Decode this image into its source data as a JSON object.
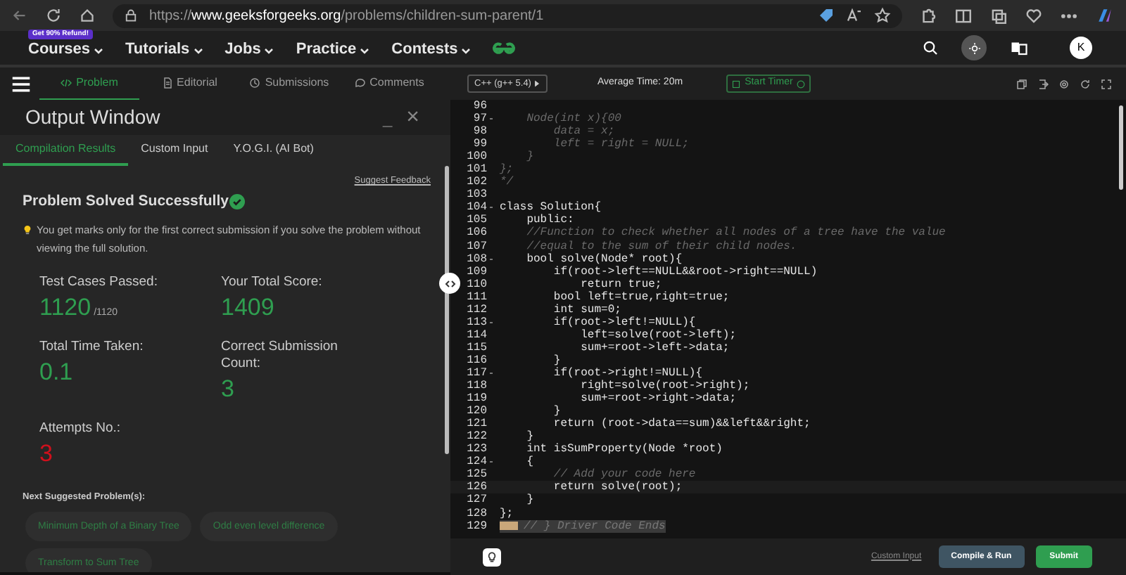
{
  "browser": {
    "url_host": "www.geeksforgeeks.org",
    "url_prefix": "https://",
    "url_path": "/problems/children-sum-parent/1"
  },
  "site_nav": {
    "badge": "Get 90% Refund!",
    "items": [
      {
        "label": "Courses"
      },
      {
        "label": "Tutorials"
      },
      {
        "label": "Jobs"
      },
      {
        "label": "Practice"
      },
      {
        "label": "Contests"
      }
    ],
    "avatar": "K"
  },
  "problem_tabs": [
    {
      "label": "Problem",
      "selected": true
    },
    {
      "label": "Editorial",
      "selected": false
    },
    {
      "label": "Submissions",
      "selected": false
    },
    {
      "label": "Comments",
      "selected": false
    }
  ],
  "output_window": {
    "title": "Output Window",
    "minimize": "_",
    "close": "×",
    "tabs": [
      {
        "label": "Compilation Results",
        "selected": true
      },
      {
        "label": "Custom Input",
        "selected": false
      },
      {
        "label": "Y.O.G.I. (AI Bot)",
        "selected": false
      }
    ],
    "feedback_link": "Suggest Feedback",
    "result_title": "Problem Solved Successfully",
    "note": "You get marks only for the first correct submission if you solve the problem without viewing the full solution.",
    "stats": [
      {
        "label": "Test Cases Passed:",
        "value": "1120",
        "suffix": "/1120",
        "color": "#2f9e50"
      },
      {
        "label": "Your Total Score:",
        "value": "1409",
        "color": "#2f9e50"
      },
      {
        "label": "Total Time Taken:",
        "value": "0.1",
        "color": "#2f9e50"
      },
      {
        "label": "Correct Submission Count:",
        "value": "3",
        "color": "#2f9e50"
      },
      {
        "label": "Attempts No.:",
        "value": "3",
        "color": "#d0101c"
      }
    ],
    "suggested_heading": "Next Suggested Problem(s):",
    "suggested": [
      "Minimum Depth of a Binary Tree",
      "Odd even level difference",
      "Transform to Sum Tree"
    ]
  },
  "editor": {
    "language": "C++ (g++ 5.4)",
    "average_time": "Average Time: 20m",
    "timer_button": "Start Timer",
    "lines": [
      {
        "n": "96",
        "kind": "comment",
        "fold": false
      },
      {
        "n": "97",
        "text": "    Node(int x){00",
        "kind": "comment",
        "fold": true
      },
      {
        "n": "98",
        "text": "        data = x;",
        "kind": "comment",
        "fold": false
      },
      {
        "n": "99",
        "text": "        left = right = NULL;",
        "kind": "comment",
        "fold": false
      },
      {
        "n": "100",
        "text": "    }",
        "kind": "comment",
        "fold": false
      },
      {
        "n": "101",
        "text": "};",
        "kind": "comment",
        "fold": false
      },
      {
        "n": "102",
        "text": "*/",
        "kind": "comment",
        "fold": false
      },
      {
        "n": "103",
        "kind": "code",
        "fold": false
      },
      {
        "n": "104",
        "text": "class Solution{",
        "kind": "code",
        "fold": true
      },
      {
        "n": "105",
        "text": "    public:",
        "kind": "code",
        "fold": false
      },
      {
        "n": "106",
        "text": "    //Function to check whether all nodes of a tree have the value",
        "kind": "comment",
        "fold": false
      },
      {
        "n": "107",
        "text": "    //equal to the sum of their child nodes.",
        "kind": "comment",
        "fold": false
      },
      {
        "n": "108",
        "text": "    bool solve(Node* root){",
        "kind": "code",
        "fold": true
      },
      {
        "n": "109",
        "text": "        if(root->left==NULL&&root->right==NULL)",
        "kind": "code",
        "fold": false
      },
      {
        "n": "110",
        "text": "            return true;",
        "kind": "code",
        "fold": false
      },
      {
        "n": "111",
        "text": "        bool left=true,right=true;",
        "kind": "code",
        "fold": false
      },
      {
        "n": "112",
        "text": "        int sum=0;",
        "kind": "code",
        "fold": false
      },
      {
        "n": "113",
        "text": "        if(root->left!=NULL){",
        "kind": "code",
        "fold": true
      },
      {
        "n": "114",
        "text": "            left=solve(root->left);",
        "kind": "code",
        "fold": false
      },
      {
        "n": "115",
        "text": "            sum+=root->left->data;",
        "kind": "code",
        "fold": false
      },
      {
        "n": "116",
        "text": "        }",
        "kind": "code",
        "fold": false
      },
      {
        "n": "117",
        "text": "        if(root->right!=NULL){",
        "kind": "code",
        "fold": true
      },
      {
        "n": "118",
        "text": "            right=solve(root->right);",
        "kind": "code",
        "fold": false
      },
      {
        "n": "119",
        "text": "            sum+=root->right->data;",
        "kind": "code",
        "fold": false
      },
      {
        "n": "120",
        "text": "        }",
        "kind": "code",
        "fold": false
      },
      {
        "n": "121",
        "text": "        return (root->data==sum)&&left&&right;",
        "kind": "code",
        "fold": false
      },
      {
        "n": "122",
        "text": "    }",
        "kind": "code",
        "fold": false
      },
      {
        "n": "123",
        "text": "    int isSumProperty(Node *root)",
        "kind": "code",
        "fold": false
      },
      {
        "n": "124",
        "text": "    {",
        "kind": "code",
        "fold": true
      },
      {
        "n": "125",
        "text": "        // Add your code here",
        "kind": "comment",
        "fold": false
      },
      {
        "n": "126",
        "text": "        return solve(root);",
        "kind": "code",
        "fold": false,
        "current": true
      },
      {
        "n": "127",
        "text": "    }",
        "kind": "code",
        "fold": false
      },
      {
        "n": "128",
        "text": "};",
        "kind": "code",
        "fold": false
      },
      {
        "n": "129",
        "text": "// } Driver Code Ends",
        "kind": "folded",
        "fold": false
      }
    ],
    "custom_input": "Custom Input",
    "compile_button": "Compile & Run",
    "submit_button": "Submit"
  }
}
